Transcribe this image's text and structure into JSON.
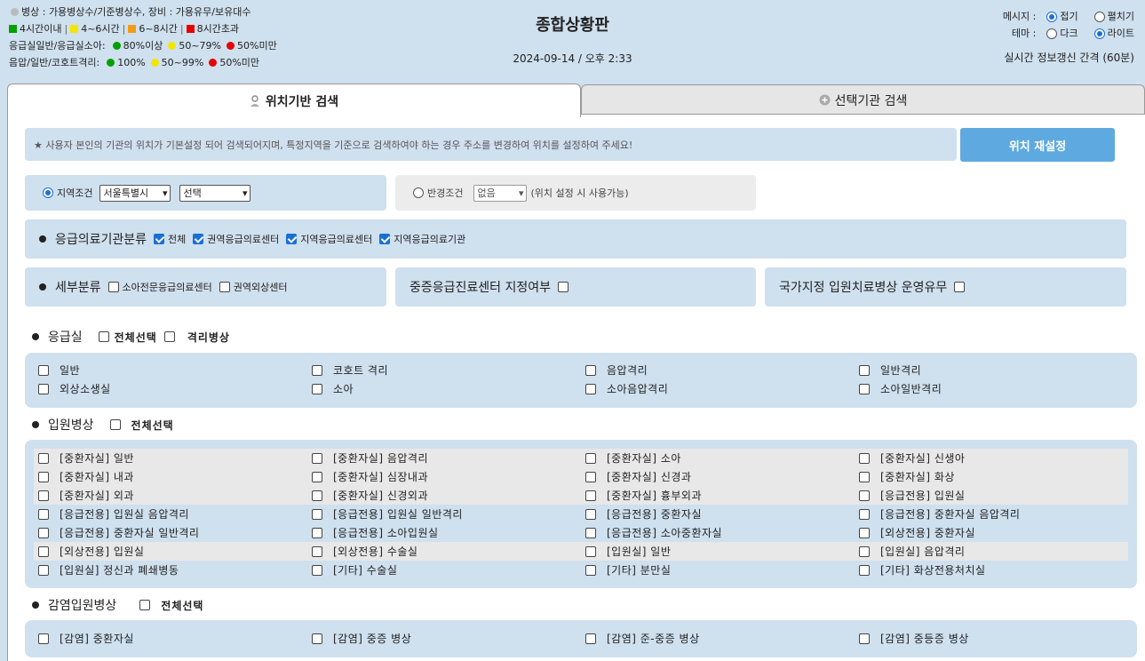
{
  "legend": {
    "line1": "병상 : 가용병상수/기준병상수, 장비 : 가용유무/보유대수",
    "line2_items": [
      {
        "label": "4시간이내",
        "color": "#00a000"
      },
      {
        "label": "4~6시간",
        "color": "#f2e600"
      },
      {
        "label": "6~8시간",
        "color": "#f39c12"
      },
      {
        "label": "8시간초과",
        "color": "#e60000"
      }
    ],
    "line3_label": "응급실일반/응급실소아:",
    "line3_items": [
      {
        "label": "80%이상",
        "color": "#00a000"
      },
      {
        "label": "50~79%",
        "color": "#f2e600"
      },
      {
        "label": "50%미만",
        "color": "#e60000"
      }
    ],
    "line4_label": "음압/일반/코호트격리:",
    "line4_items": [
      {
        "label": "100%",
        "color": "#00a000"
      },
      {
        "label": "50~99%",
        "color": "#f2e600"
      },
      {
        "label": "50%미만",
        "color": "#e60000"
      }
    ]
  },
  "header": {
    "title": "종합상황판",
    "datetime": "2024-09-14 / 오후 2:33",
    "message_label": "메시지 :",
    "message_options": [
      "접기",
      "펼치기"
    ],
    "theme_label": "테마 :",
    "theme_options": [
      "다크",
      "라이트"
    ],
    "refresh": "실시간 정보갱신 간격 (60분)"
  },
  "tabs": [
    "위치기반 검색",
    "선택기관 검색"
  ],
  "notice": "★ 사용자 본인의 기관의 위치가 기본설정 되어 검색되어지며, 특정지역을 기준으로 검색하여야 하는 경우 주소를 변경하여 위치를 설정하여 주세요!",
  "reset_button": "위치 재설정",
  "region": {
    "label": "지역조건",
    "sido": "서울특별시",
    "sigungu": "선택"
  },
  "radius": {
    "label": "반경조건",
    "value": "없음",
    "note": "(위치 설정 시 사용가능)"
  },
  "category": {
    "title": "응급의료기관분류",
    "items": [
      "전체",
      "권역응급의료센터",
      "지역응급의료센터",
      "지역응급의료기관"
    ]
  },
  "subcategory": {
    "title": "세부분류",
    "items": [
      "소아전문응급의료센터",
      "권역외상센터"
    ]
  },
  "severe_center": "중증응급진료센터 지정여부",
  "national_bed": "국가지정 입원치료병상 운영유무",
  "er": {
    "title": "응급실",
    "select_all": "전체선택",
    "isolation": "격리병상",
    "rows": [
      [
        "일반",
        "코호트 격리",
        "음압격리",
        "일반격리"
      ],
      [
        "외상소생실",
        "소아",
        "소아음압격리",
        "소아일반격리"
      ]
    ]
  },
  "inpatient": {
    "title": "입원병상",
    "select_all": "전체선택",
    "rows": [
      [
        "[중환자실] 일반",
        "[중환자실] 음압격리",
        "[중환자실] 소아",
        "[중환자실] 신생아"
      ],
      [
        "[중환자실] 내과",
        "[중환자실] 심장내과",
        "[중환자실] 신경과",
        "[중환자실] 화상"
      ],
      [
        "[중환자실] 외과",
        "[중환자실] 신경외과",
        "[중환자실] 흉부외과",
        "[응급전용] 입원실"
      ],
      [
        "[응급전용] 입원실 음압격리",
        "[응급전용] 입원실 일반격리",
        "[응급전용] 중환자실",
        "[응급전용] 중환자실 음압격리"
      ],
      [
        "[응급전용] 중환자실 일반격리",
        "[응급전용] 소아입원실",
        "[응급전용] 소아중환자실",
        "[외상전용] 중환자실"
      ],
      [
        "[외상전용] 입원실",
        "[외상전용] 수술실",
        "[입원실] 일반",
        "[입원실] 음압격리"
      ],
      [
        "[입원실] 정신과 폐쇄병동",
        "[기타] 수술실",
        "[기타] 분만실",
        "[기타] 화상전용처치실"
      ]
    ]
  },
  "infection": {
    "title": "감염입원병상",
    "select_all": "전체선택",
    "rows": [
      [
        "[감염] 중환자실",
        "[감염] 중증 병상",
        "[감염] 준-중증 병상",
        "[감염] 중등증 병상"
      ]
    ]
  }
}
